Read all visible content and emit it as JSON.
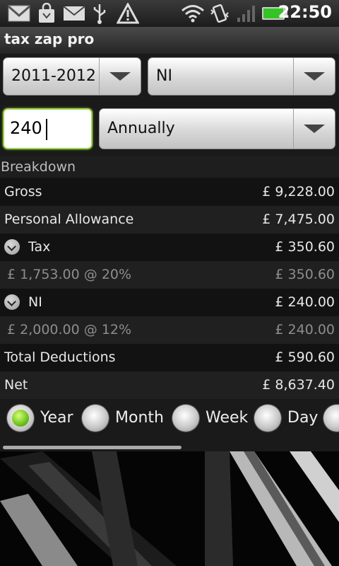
{
  "status_bar": {
    "icons": [
      "gmail-icon",
      "shopping-bag-icon",
      "email-icon",
      "usb-icon",
      "warning-icon",
      "wifi-icon",
      "vibrate-icon",
      "signal-icon",
      "battery-icon"
    ],
    "time": "22:50"
  },
  "app": {
    "title": "tax zap pro"
  },
  "controls": {
    "year_spinner": {
      "value": "2011-2012"
    },
    "type_spinner": {
      "value": "NI"
    },
    "amount_input": {
      "value": "240"
    },
    "period_spinner": {
      "value": "Annually"
    }
  },
  "breakdown": {
    "header": "Breakdown",
    "rows": [
      {
        "label": "Gross",
        "value": "£ 9,228.00"
      },
      {
        "label": "Personal Allowance",
        "value": "£ 7,475.00"
      },
      {
        "label": "Tax",
        "value": "£ 350.60",
        "expandable": true
      },
      {
        "label": "£ 1,753.00 @ 20%",
        "value": "£ 350.60",
        "sub": true
      },
      {
        "label": "NI",
        "value": "£ 240.00",
        "expandable": true
      },
      {
        "label": "£ 2,000.00 @ 12%",
        "value": "£ 240.00",
        "sub": true
      },
      {
        "label": "Total Deductions",
        "value": "£ 590.60"
      },
      {
        "label": "Net",
        "value": "£ 8,637.40"
      }
    ]
  },
  "period_options": [
    {
      "label": "Year",
      "selected": true
    },
    {
      "label": "Month",
      "selected": false
    },
    {
      "label": "Week",
      "selected": false
    },
    {
      "label": "Day",
      "selected": false
    }
  ],
  "colors": {
    "accent_green": "#7fbf2a",
    "background": "#1a1a1a"
  }
}
